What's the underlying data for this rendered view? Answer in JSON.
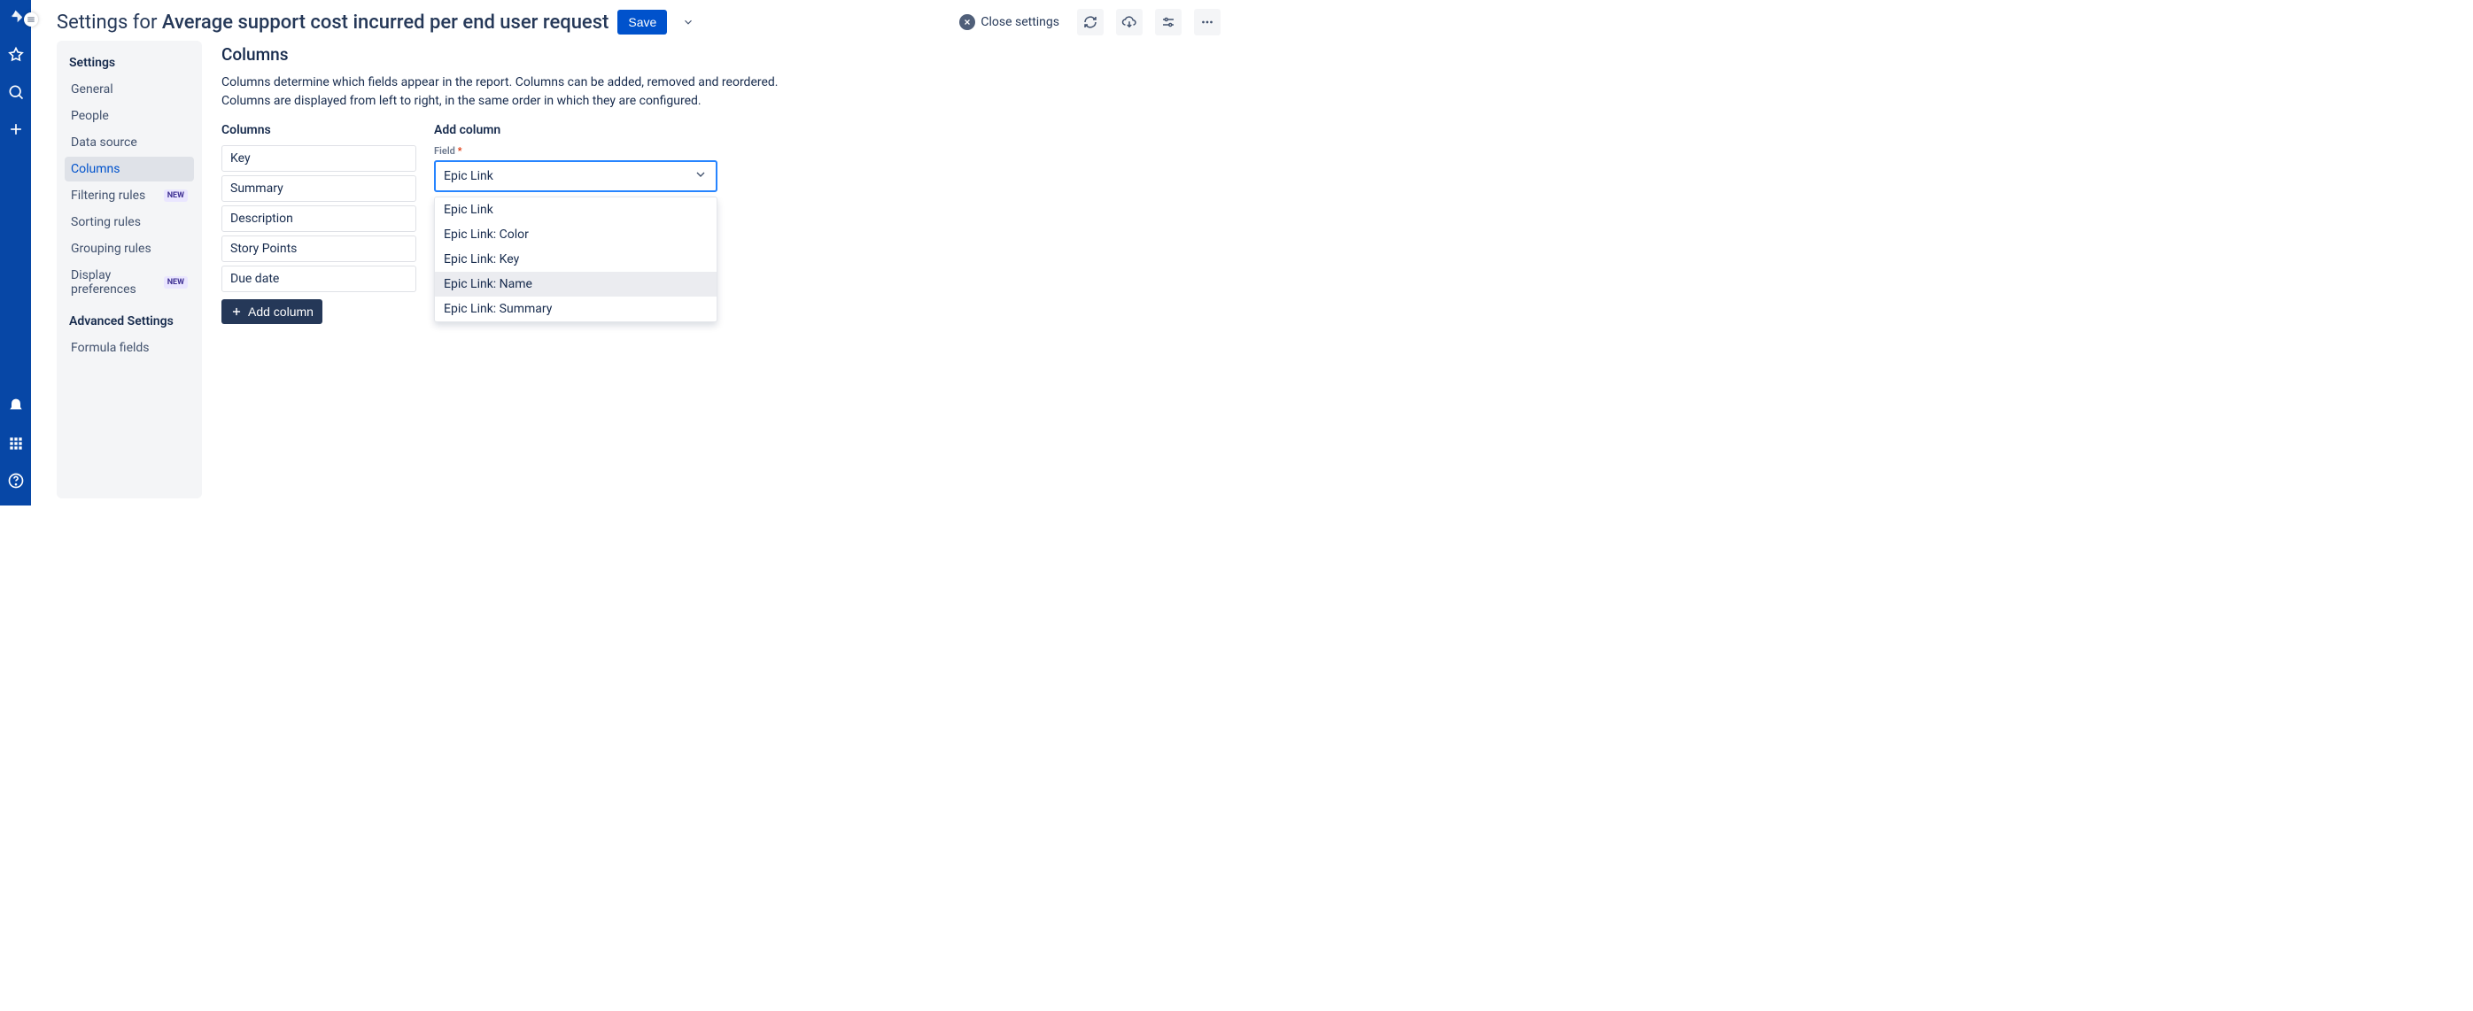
{
  "header": {
    "title_prefix": "Settings for ",
    "title_subject": "Average support cost incurred per end user request",
    "save_label": "Save",
    "close_label": "Close settings"
  },
  "sidebar": {
    "group1_title": "Settings",
    "group2_title": "Advanced Settings",
    "new_badge": "NEW",
    "items1": [
      {
        "label": "General"
      },
      {
        "label": "People"
      },
      {
        "label": "Data source"
      },
      {
        "label": "Columns",
        "active": true
      },
      {
        "label": "Filtering rules",
        "new": true
      },
      {
        "label": "Sorting rules"
      },
      {
        "label": "Grouping rules"
      },
      {
        "label": "Display preferences",
        "new": true
      }
    ],
    "items2": [
      {
        "label": "Formula fields"
      }
    ]
  },
  "content": {
    "heading": "Columns",
    "description": "Columns determine which fields appear in the report. Columns can be added, removed and reordered. Columns are displayed from left to right, in the same order in which they are configured.",
    "columns_title": "Columns",
    "add_column_title": "Add column",
    "columns": [
      "Key",
      "Summary",
      "Description",
      "Story Points",
      "Due date"
    ],
    "add_button_label": "Add column",
    "field_label": "Field",
    "field_value": "Epic Link",
    "field_options": [
      {
        "label": "Epic Link"
      },
      {
        "label": "Epic Link: Color"
      },
      {
        "label": "Epic Link: Key"
      },
      {
        "label": "Epic Link: Name",
        "highlight": true
      },
      {
        "label": "Epic Link: Summary"
      }
    ]
  }
}
